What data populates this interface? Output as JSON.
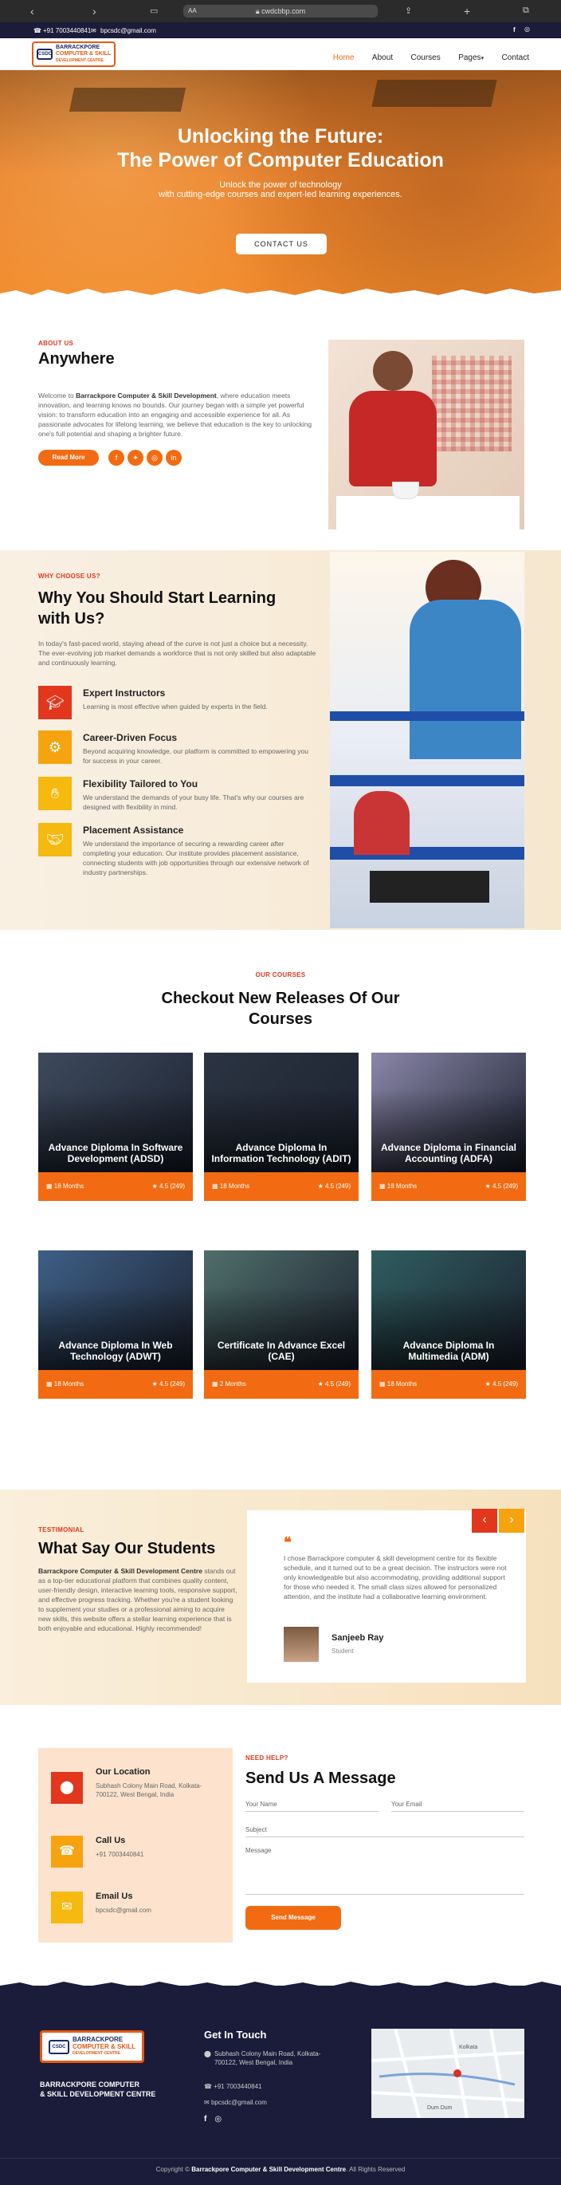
{
  "browser": {
    "aa": "AA",
    "url": "cwdcbbp.com"
  },
  "topbar": {
    "phone": "+91 7003440841",
    "email": "bpcsdc@gmail.com"
  },
  "nav": {
    "logo_line1": "BARRACKPORE",
    "logo_line2": "COMPUTER & SKILL",
    "logo_line3": "DEVELOPMENT CENTRE",
    "logo_mark": "CSDC",
    "items": [
      "Home",
      "About",
      "Courses",
      "Pages",
      "Contact"
    ],
    "active": "Home"
  },
  "hero": {
    "title1": "Unlocking the Future:",
    "title2": "The Power of Computer Education",
    "sub1": "Unlock the power of technology",
    "sub2": "with cutting-edge courses and expert-led learning experiences.",
    "cta": "CONTACT US"
  },
  "about": {
    "kicker": "ABOUT US",
    "title": "Anywhere",
    "p_lead": "Welcome to ",
    "p_brand": "Barrackpore Computer & Skill Development",
    "p_rest": ", where education meets innovation, and learning knows no bounds. Our journey began with a simple yet powerful vision: to transform education into an engaging and accessible experience for all. As passionate advocates for lifelong learning, we believe that education is the key to unlocking one's full potential and shaping a brighter future.",
    "btn": "Read More"
  },
  "why": {
    "kicker": "WHY CHOOSE US?",
    "title1": "Why You Should Start Learning",
    "title2": "with Us?",
    "intro": "In today's fast-paced world, staying ahead of the curve is not just a choice but a necessity. The ever-evolving job market demands a workforce that is not only skilled but also adaptable and continuously learning.",
    "features": [
      {
        "title": "Expert Instructors",
        "text": "Learning is most effective when guided by experts in the field.",
        "icon": "graduation-cap-icon",
        "color": "#e2361d"
      },
      {
        "title": "Career-Driven Focus",
        "text": "Beyond acquiring knowledge, our platform is committed to empowering you for success in your career.",
        "icon": "gear-icon",
        "color": "#f5a30f"
      },
      {
        "title": "Flexibility Tailored to You",
        "text": "We understand the demands of your busy life. That's why our courses are designed with flexibility in mind.",
        "icon": "hand-icon",
        "color": "#f5b90f"
      },
      {
        "title": "Placement Assistance",
        "text": "We understand the importance of securing a rewarding career after completing your education. Our institute provides placement assistance, connecting students with job opportunities through our extensive network of industry partnerships.",
        "icon": "handshake-icon",
        "color": "#f5b90f"
      }
    ]
  },
  "courses": {
    "kicker": "OUR COURSES",
    "title1": "Checkout New Releases Of Our",
    "title2": "Courses",
    "items": [
      {
        "title": "Advance Diploma In Software Development (ADSD)",
        "duration": "18 Months",
        "rating": "4.5 (249)",
        "bg": "#3d4a5c"
      },
      {
        "title": "Advance Diploma In Information Technology (ADIT)",
        "duration": "18 Months",
        "rating": "4.5 (249)",
        "bg": "#2b3442"
      },
      {
        "title": "Advance Diploma in Financial Accounting (ADFA)",
        "duration": "18 Months",
        "rating": "4.5 (249)",
        "bg": "#8a86a8"
      },
      {
        "title": "Advance Diploma In Web Technology (ADWT)",
        "duration": "18 Months",
        "rating": "4.5 (249)",
        "bg": "#3e5f86"
      },
      {
        "title": "Certificate In Advance Excel (CAE)",
        "duration": "2 Months",
        "rating": "4.5 (249)",
        "bg": "#4f6e6a"
      },
      {
        "title": "Advance Diploma In Multimedia (ADM)",
        "duration": "18 Months",
        "rating": "4.5 (249)",
        "bg": "#2f5d5f"
      }
    ]
  },
  "testimonial": {
    "kicker": "TESTIMONIAL",
    "title": "What Say Our Students",
    "p_brand": "Barrackpore Computer & Skill Development Centre",
    "p_rest": " stands out as a top-tier educational platform that combines quality content, user-friendly design, interactive learning tools, responsive support, and effective progress tracking. Whether you're a student looking to supplement your studies or a professional aiming to acquire new skills, this website offers a stellar learning experience that is both enjoyable and educational. Highly recommended!",
    "quote": "I chose Barrackpore computer & skill development centre for its flexible schedule, and it turned out to be a great decision. The instructors were not only knowledgeable but also accommodating, providing additional support for those who needed it. The small class sizes allowed for personalized attention, and the institute had a collaborative learning environment.",
    "name": "Sanjeeb Ray",
    "role": "Student",
    "prev": "‹",
    "next": "›"
  },
  "contact": {
    "location_title": "Our Location",
    "location_text": "Subhash Colony Main Road, Kolkata-700122, West Bengal, India",
    "call_title": "Call Us",
    "call_text": "+91 7003440841",
    "email_title": "Email Us",
    "email_text": "bpcsdc@gmail.com",
    "kicker": "NEED HELP?",
    "title": "Send Us A Message",
    "name_ph": "Your Name",
    "email_ph": "Your Email",
    "subject_ph": "Subject",
    "message_ph": "Message",
    "btn": "Send Message"
  },
  "footer": {
    "brand1": "BARRACKPORE COMPUTER",
    "brand2": "& SKILL DEVELOPMENT CENTRE",
    "git": "Get In Touch",
    "address": "Subhash Colony Main Road, Kolkata-700122, West Bengal, India",
    "phone": "+91 7003440841",
    "email": "bpcsdc@gmail.com",
    "copy_pre": "Copyright © ",
    "copy_brand": "Barrackpore Computer & Skill Development Centre",
    "copy_post": ". All Rights Reserved",
    "map_labels": [
      "Kolkata",
      "Dum Dum"
    ]
  }
}
